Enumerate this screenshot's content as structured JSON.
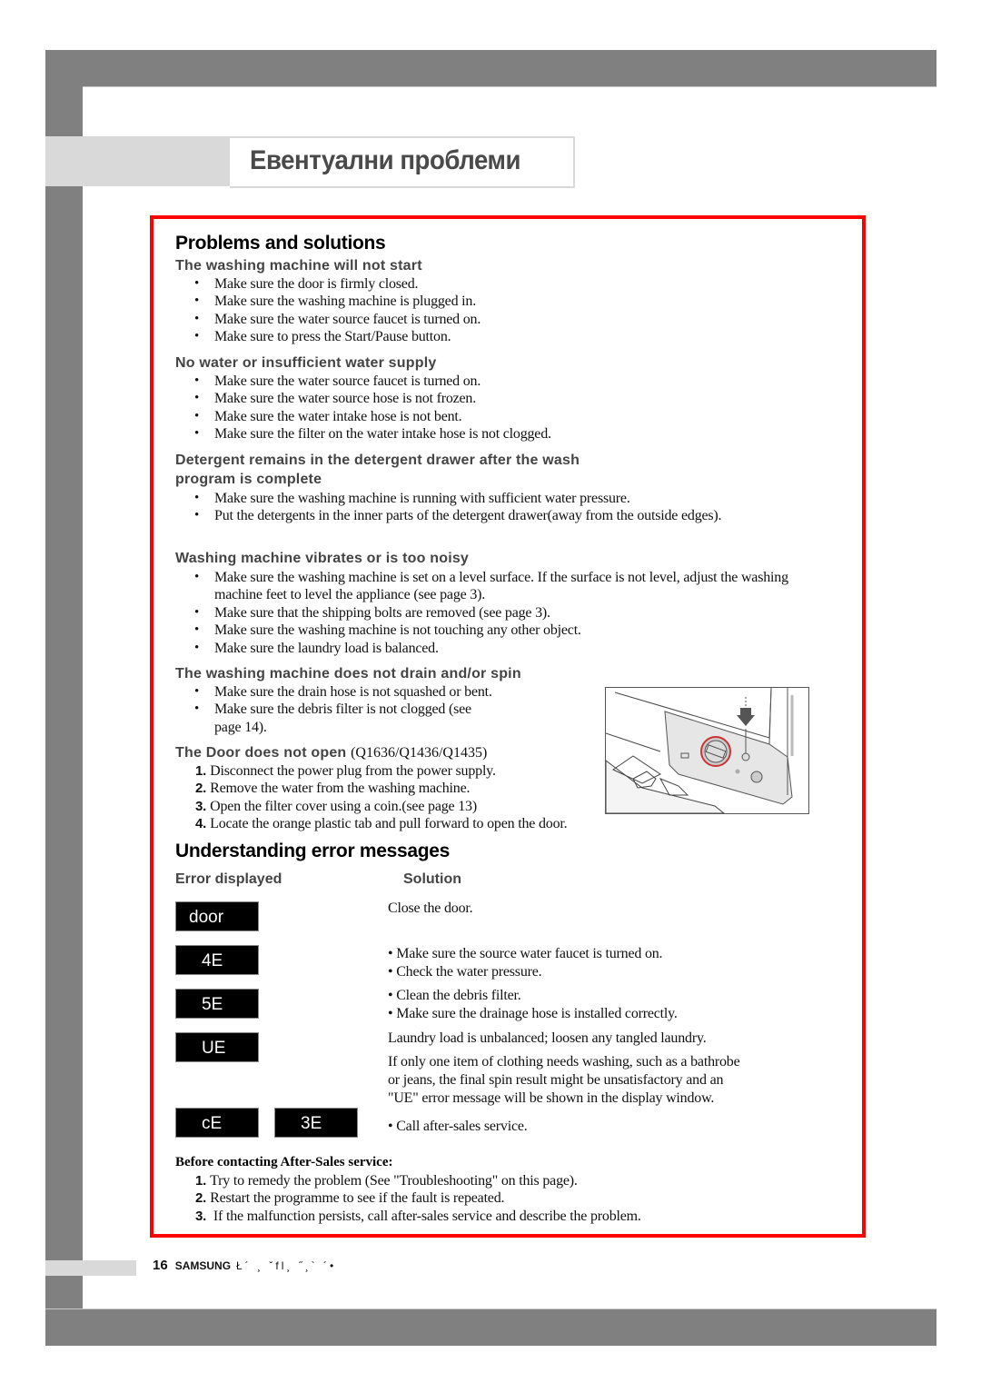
{
  "page": {
    "title": "Евентуални проблеми",
    "footer": {
      "page_number": "16",
      "brand": "SAMSUNG",
      "garbled_text": "Ł´ ¸ ˇfl¸   ˝¸`   ´•"
    },
    "accent_color": "#ff0000"
  },
  "problems": {
    "heading": "Problems and solutions",
    "sections": [
      {
        "title": "The washing machine will not start",
        "items": [
          "Make sure the door is firmly closed.",
          "Make sure the washing machine is plugged in.",
          "Make sure the water source faucet is turned on.",
          "Make sure to press the Start/Pause button."
        ]
      },
      {
        "title": "No water or insufficient water supply",
        "items": [
          "Make sure the water source faucet is turned on.",
          "Make sure the water source hose is not frozen.",
          "Make sure the water intake hose is not bent.",
          "Make sure the filter on the water intake hose is not clogged."
        ]
      },
      {
        "title_line1": "Detergent remains in the detergent drawer after the wash",
        "title_line2": "program is complete",
        "items": [
          "Make sure the washing machine is running with sufficient water pressure.",
          "Put the detergents in the inner parts of the detergent drawer(away from the outside edges)."
        ]
      },
      {
        "title": "Washing machine vibrates or is too noisy",
        "items": [
          "Make sure the washing machine is set on a level surface.  If the surface is not level, adjust the washing machine feet to level the appliance (see page 3).",
          "Make sure that the shipping bolts are removed (see page 3).",
          "Make sure the washing machine is not touching any other object.",
          "Make sure the laundry load is balanced."
        ]
      },
      {
        "title": "The washing machine does not drain and/or spin",
        "items": [
          "Make sure the drain hose is not squashed or bent.",
          "Make sure the debris filter is not clogged (see page 14)."
        ]
      }
    ],
    "door": {
      "title": "The Door does not open",
      "models": "(Q1636/Q1436/Q1435)",
      "steps": [
        {
          "n": "1.",
          "text": "Disconnect the power plug from the power supply."
        },
        {
          "n": "2.",
          "text": "Remove the water from the washing machine."
        },
        {
          "n": "3.",
          "text": "Open the filter cover using a coin.(see page 13)"
        },
        {
          "n": "4.",
          "text": "Locate the orange plastic tab and pull forward to open the door."
        }
      ],
      "illustration": "filter-cover-illustration"
    }
  },
  "errors": {
    "heading": "Understanding error messages",
    "col_error": "Error displayed",
    "col_solution": "Solution",
    "rows": [
      {
        "codes": [
          "door"
        ],
        "solution": [
          "Close the door."
        ]
      },
      {
        "codes": [
          "4E"
        ],
        "solution": [
          "• Make sure the source water faucet is turned on.",
          "• Check the water pressure."
        ]
      },
      {
        "codes": [
          "5E"
        ],
        "solution": [
          "• Clean the debris filter.",
          "• Make sure the drainage hose is installed correctly."
        ]
      },
      {
        "codes": [
          "UE"
        ],
        "solution": [
          "Laundry load is unbalanced; loosen any tangled laundry.",
          "If only one item of clothing needs washing, such as a bathrobe",
          "or jeans, the final spin result might be unsatisfactory and an",
          "\"UE\" error message will be shown in the display window."
        ]
      },
      {
        "codes": [
          "cE",
          "3E"
        ],
        "solution": [
          "• Call after-sales service."
        ]
      }
    ]
  },
  "after_sales": {
    "heading": "Before contacting After-Sales service:",
    "steps": [
      {
        "n": "1.",
        "text": "Try to remedy the problem (See \"Troubleshooting\" on this page)."
      },
      {
        "n": "2.",
        "text": "Restart the programme to see if the fault is repeated."
      },
      {
        "n": "3.",
        "text": " If the malfunction persists, call after-sales service and describe the problem."
      }
    ]
  }
}
